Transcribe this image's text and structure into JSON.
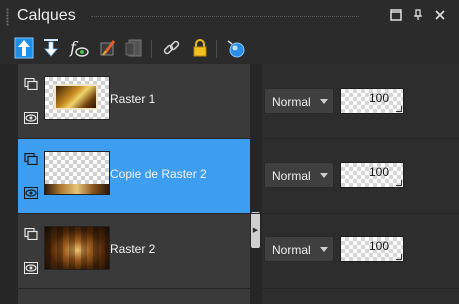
{
  "panel": {
    "title": "Calques"
  },
  "window_buttons": [
    {
      "name": "maximize-icon",
      "glyph": "□"
    },
    {
      "name": "pin-icon",
      "glyph": "⊥"
    },
    {
      "name": "close-icon",
      "glyph": "✕"
    }
  ],
  "toolbar": {
    "tools": [
      "move-layer-up-icon",
      "move-layer-down-icon",
      "fx-effects-icon",
      "brush-icon",
      "mask-icon",
      "link-icon",
      "lock-icon",
      "new-layer-icon"
    ]
  },
  "layers": [
    {
      "name": "Raster 1",
      "blend_mode": "Normal",
      "opacity": "100",
      "selected": false
    },
    {
      "name": "Copie de Raster 2",
      "blend_mode": "Normal",
      "opacity": "100",
      "selected": true
    },
    {
      "name": "Raster 2",
      "blend_mode": "Normal",
      "opacity": "100",
      "selected": false
    }
  ],
  "colors": {
    "selection": "#3d9df0",
    "background": "#2b2b2b"
  }
}
